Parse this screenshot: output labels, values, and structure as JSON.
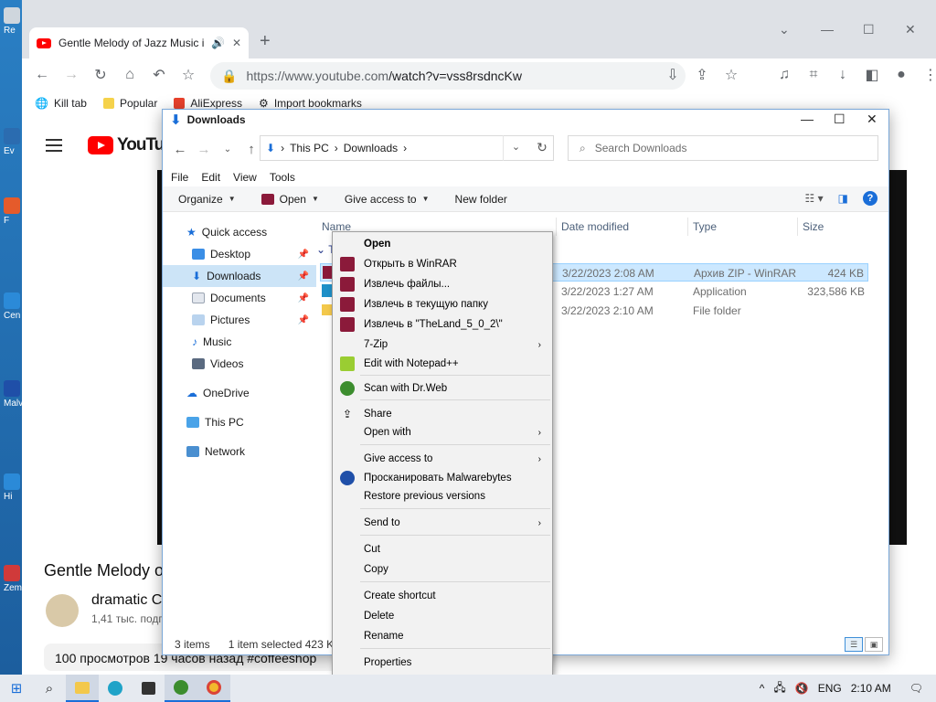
{
  "desktop": {
    "icons": [
      {
        "label": "Re"
      },
      {
        "label": "Ev"
      },
      {
        "label": "F"
      },
      {
        "label": "Cen"
      },
      {
        "label": "Malv"
      },
      {
        "label": "Hi"
      },
      {
        "label": "Zem"
      }
    ]
  },
  "browser": {
    "tab_title": "Gentle Melody of Jazz Music in",
    "new_tab": "+",
    "url_scheme_host": "https://www.youtube.com",
    "url_path": "/watch?v=vss8rsdncKw",
    "bookmarks": [
      {
        "label": "Kill tab"
      },
      {
        "label": "Popular"
      },
      {
        "label": "AliExpress"
      },
      {
        "label": "Import bookmarks"
      }
    ]
  },
  "youtube": {
    "logo_text": "YouTub",
    "video_title": "Gentle Melody o",
    "channel": "dramatic C",
    "subscribers": "1,41 тыс. подп",
    "description": "100 просмотров  19 часов назад  #coffeeshop"
  },
  "explorer": {
    "title": "Downloads",
    "breadcrumb": [
      "This PC",
      "Downloads"
    ],
    "search_placeholder": "Search Downloads",
    "menubar": [
      "File",
      "Edit",
      "View",
      "Tools"
    ],
    "commands": {
      "organize": "Organize",
      "open": "Open",
      "give_access": "Give access to",
      "new_folder": "New folder"
    },
    "nav": {
      "quick_access": "Quick access",
      "desktop": "Desktop",
      "downloads": "Downloads",
      "documents": "Documents",
      "pictures": "Pictures",
      "music": "Music",
      "videos": "Videos",
      "onedrive": "OneDrive",
      "this_pc": "This PC",
      "network": "Network"
    },
    "columns": {
      "name": "Name",
      "date": "Date modified",
      "type": "Type",
      "size": "Size"
    },
    "group_header": "T",
    "files": [
      {
        "date": "3/22/2023 2:08 AM",
        "type": "Архив ZIP - WinRAR",
        "size": "424 KB"
      },
      {
        "date": "3/22/2023 1:27 AM",
        "type": "Application",
        "size": "323,586 KB"
      },
      {
        "date": "3/22/2023 2:10 AM",
        "type": "File folder",
        "size": ""
      }
    ],
    "status": {
      "items": "3 items",
      "selected": "1 item selected  423 K"
    }
  },
  "context_menu": {
    "open": "Open",
    "open_winrar": "Открыть в WinRAR",
    "extract_files": "Извлечь файлы...",
    "extract_here": "Извлечь в текущую папку",
    "extract_to": "Извлечь в \"TheLand_5_0_2\\\"",
    "sevenzip": "7-Zip",
    "notepad": "Edit with Notepad++",
    "drweb": "Scan with Dr.Web",
    "share": "Share",
    "open_with": "Open with",
    "give_access": "Give access to",
    "malwarebytes": "Просканировать Malwarebytes",
    "restore": "Restore previous versions",
    "send_to": "Send to",
    "cut": "Cut",
    "copy": "Copy",
    "create_shortcut": "Create shortcut",
    "delete": "Delete",
    "rename": "Rename",
    "properties": "Properties"
  },
  "taskbar": {
    "language": "ENG",
    "time": "2:10 AM"
  },
  "colors": {
    "accent": "#1a6ed8",
    "selection": "#cce8ff",
    "youtube_red": "#ff0000",
    "winrar": "#8b1a3a"
  }
}
